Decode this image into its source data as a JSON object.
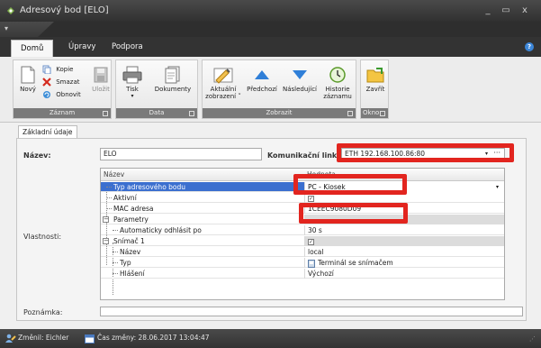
{
  "window": {
    "title": "Adresový bod [ELO]",
    "controls": [
      "_",
      "▭",
      "x"
    ]
  },
  "ribbon_tabs": [
    "Domů",
    "Úpravy",
    "Podpora"
  ],
  "ribbon": {
    "groups": {
      "zaznam": {
        "label": "Záznam",
        "novy": "Nový",
        "kopie": "Kopie",
        "smazat": "Smazat",
        "obnovit": "Obnovit",
        "ulozit": "Uložit"
      },
      "data": {
        "label": "Data",
        "tisk": "Tisk",
        "dokumenty": "Dokumenty"
      },
      "zobrazit": {
        "label": "Zobrazit",
        "aktualni_1": "Aktuální",
        "aktualni_2": "zobrazení ˅",
        "predchozi": "Předchozí",
        "nasledujici": "Následující",
        "historie_1": "Historie",
        "historie_2": "záznamu"
      },
      "okno": {
        "label": "Okno",
        "zavrit": "Zavřít"
      }
    }
  },
  "content": {
    "tab_label": "Základní údaje",
    "nazev_label": "Název:",
    "nazev_value": "ELO",
    "link_label": "Komunikační linka:",
    "link_value": "ETH 192.168.100.86:80",
    "vlastnosti_label": "Vlastnosti:",
    "poznamka_label": "Poznámka:"
  },
  "grid": {
    "header_name": "Název",
    "header_value": "Hodnota",
    "rows": [
      {
        "name": "Typ adresového bodu",
        "value": "PC - Kiosek"
      },
      {
        "name": "Aktivní",
        "value": "✓"
      },
      {
        "name": "MAC adresa",
        "value": "1CEEC9080D09"
      },
      {
        "name": "Parametry",
        "value": ""
      },
      {
        "name": "Automaticky odhlásit po",
        "value": "30 s"
      },
      {
        "name": "Snímač 1",
        "value": "✓"
      },
      {
        "name": "Název",
        "value": "local"
      },
      {
        "name": "Typ",
        "value": "Terminál se snímačem"
      },
      {
        "name": "Hlášení",
        "value": "Výchozí"
      }
    ]
  },
  "status": {
    "changed_by": "Změnil: Eichler",
    "changed_time": "Čas změny: 28.06.2017 13:04:47"
  },
  "colors": {
    "highlight": "#e2251f",
    "selection": "#3b6fcf",
    "titlebar": "#3a3a3a"
  }
}
